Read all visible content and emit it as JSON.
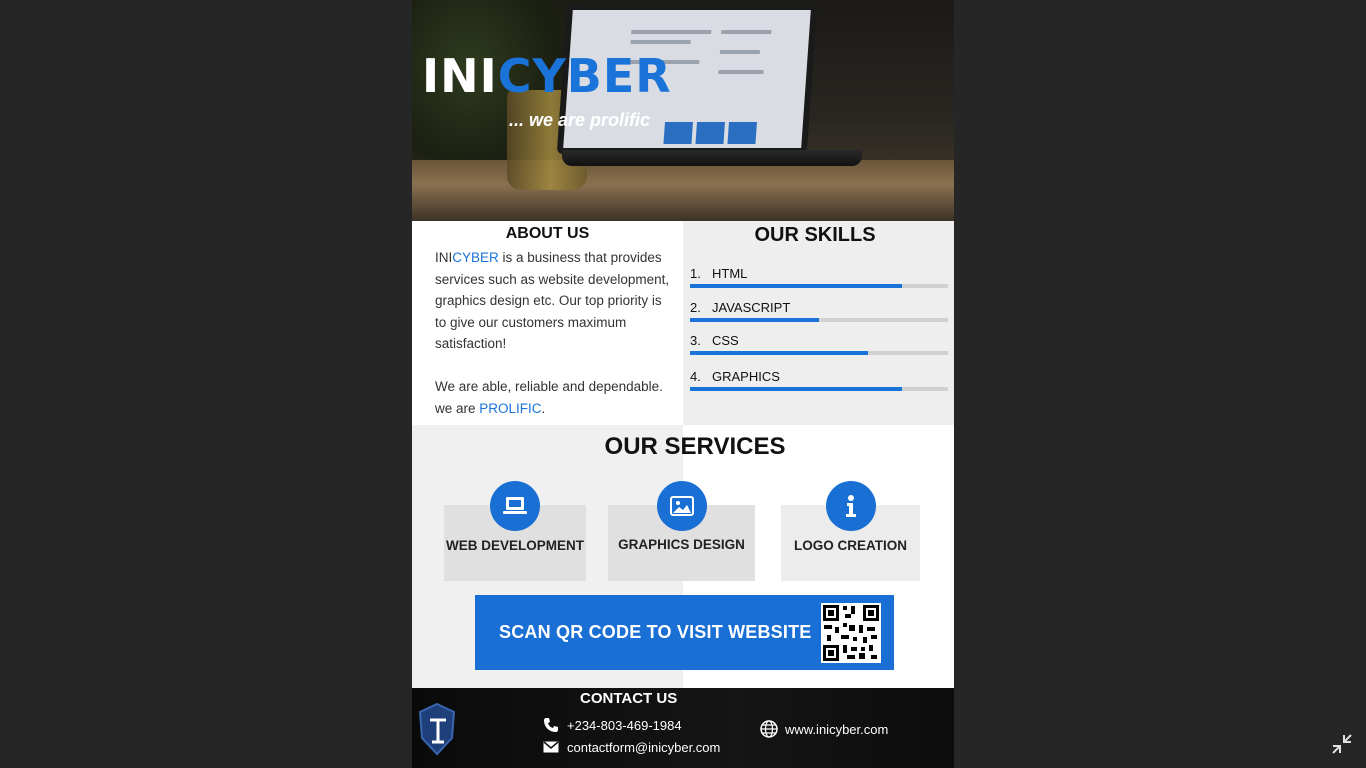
{
  "hero": {
    "brand_prefix": "INI",
    "brand_suffix": "CYBER",
    "tagline": "... we are prolific"
  },
  "about": {
    "heading": "ABOUT US",
    "p1_brand_prefix": "INI",
    "p1_brand_suffix": "CYBER",
    "p1_text": " is a business that provides services such as website development, graphics design etc. Our top priority is to give our customers maximum satisfaction!",
    "p2_text": "We are able, reliable and dependable. we are ",
    "p2_highlight": "PROLIFIC",
    "p2_end": "."
  },
  "skills": {
    "heading": "OUR SKILLS",
    "items": [
      {
        "num": "1.",
        "label": "HTML",
        "level": 0.82
      },
      {
        "num": "2.",
        "label": "JAVASCRIPT",
        "level": 0.5
      },
      {
        "num": "3.",
        "label": "CSS",
        "level": 0.69
      },
      {
        "num": "4.",
        "label": "GRAPHICS",
        "level": 0.82
      }
    ]
  },
  "services": {
    "heading": "OUR SERVICES",
    "items": [
      {
        "label": "WEB DEVELOPMENT",
        "icon": "laptop-icon"
      },
      {
        "label": "GRAPHICS DESIGN",
        "icon": "image-icon"
      },
      {
        "label": "LOGO CREATION",
        "icon": "info-icon"
      }
    ],
    "qr_banner": "SCAN QR CODE TO VISIT WEBSITE"
  },
  "contact": {
    "heading": "CONTACT US",
    "phone": "+234-803-469-1984",
    "email": "contactform@inicyber.com",
    "website": "www.inicyber.com"
  },
  "colors": {
    "accent": "#1a73d9",
    "background": "#262626"
  }
}
